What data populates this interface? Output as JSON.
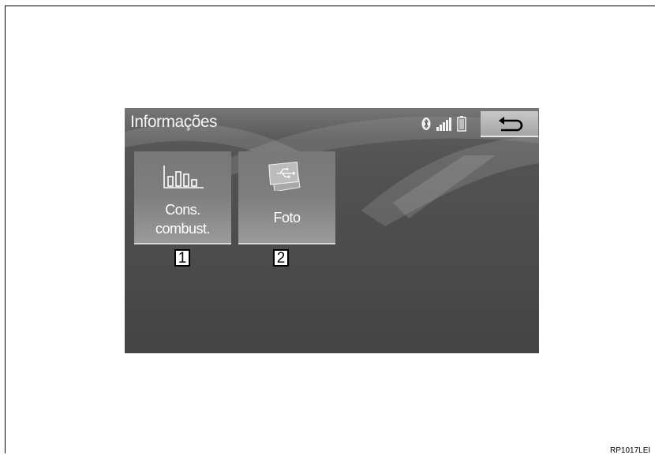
{
  "screen": {
    "title": "Informações",
    "status_icons": [
      "bluetooth-icon",
      "signal-strength-icon",
      "battery-icon"
    ],
    "back_button": {
      "icon": "back-arrow-icon"
    }
  },
  "tiles": [
    {
      "line1": "Cons.",
      "line2": "combust.",
      "icon": "bar-chart-icon"
    },
    {
      "line1": "Foto",
      "line2": "",
      "icon": "usb-photo-icon"
    }
  ],
  "callouts": [
    "1",
    "2"
  ],
  "caption": "RP1017LEI",
  "colors": {
    "screen_bg": "#4a4a4a",
    "tile": "#808080",
    "text": "#ffffff"
  }
}
